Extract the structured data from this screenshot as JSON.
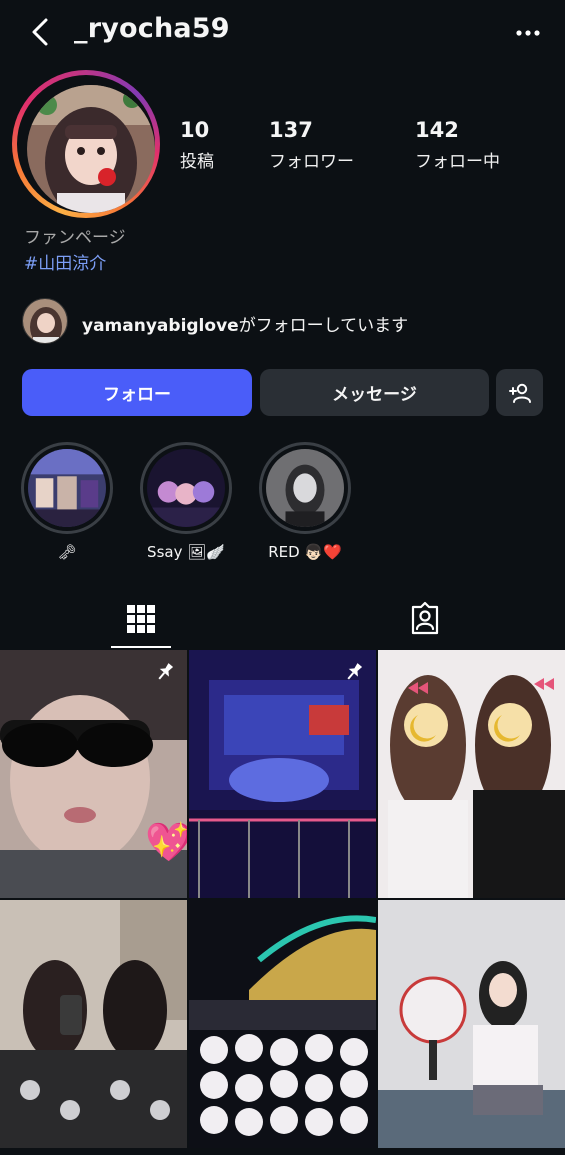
{
  "header": {
    "username": "_ryocha59",
    "back_icon": "chevron-left-icon",
    "more_icon": "more-dots-icon"
  },
  "profile": {
    "stats": [
      {
        "num": "10",
        "label": "投稿"
      },
      {
        "num": "137",
        "label": "フォロワー"
      },
      {
        "num": "142",
        "label": "フォロー中"
      }
    ],
    "category": "ファンページ",
    "hashtag": "#山田涼介"
  },
  "followed_by": {
    "username": "yamanyabiglove",
    "text": "がフォローしています"
  },
  "actions": {
    "follow": "フォロー",
    "message": "メッセージ",
    "add_user_icon": "person-add-icon"
  },
  "highlights": [
    {
      "label": "🗝"
    },
    {
      "label": "Ssay 🖼🪽"
    },
    {
      "label": "RED 👦🏻❤️"
    }
  ],
  "tabs": {
    "grid_icon": "grid-icon",
    "tagged_icon": "tagged-person-icon"
  },
  "colors": {
    "background": "#0c1014",
    "follow_button": "#4a5df9",
    "secondary_button": "#2a2f35",
    "hashtag": "#7c9ef5"
  }
}
